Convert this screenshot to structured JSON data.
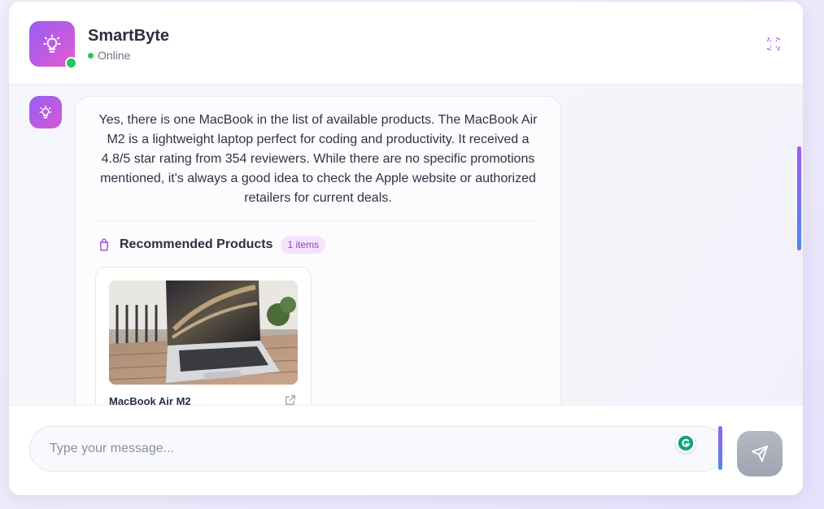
{
  "header": {
    "title": "SmartByte",
    "status": "Online",
    "avatar_icon": "lightbulb-icon",
    "expand_icon": "expand-icon"
  },
  "chat": {
    "messages": [
      {
        "sender": "bot",
        "avatar_icon": "lightbulb-icon",
        "text": "Yes, there is one MacBook in the list of available products.  The MacBook Air M2 is a lightweight laptop perfect for coding and productivity.  It received a 4.8/5 star rating from 354 reviewers.  While there are no specific promotions mentioned, it's always a good idea to check the Apple website or authorized retailers for current deals.",
        "recommendations": {
          "title": "Recommended Products",
          "count_badge": "1 items",
          "icon": "shopping-bag-icon",
          "products": [
            {
              "name": "MacBook Air M2",
              "link_icon": "external-link-icon"
            }
          ]
        }
      }
    ]
  },
  "input": {
    "placeholder": "Type your message...",
    "value": "",
    "send_icon": "send-icon",
    "extension_icon": "grammarly-icon"
  },
  "colors": {
    "accent_purple": "#9b5cf5",
    "accent_blue": "#4f86f0",
    "online_green": "#22c55e",
    "badge_text": "#9b3ec9",
    "badge_bg": "#f3e3fb"
  }
}
